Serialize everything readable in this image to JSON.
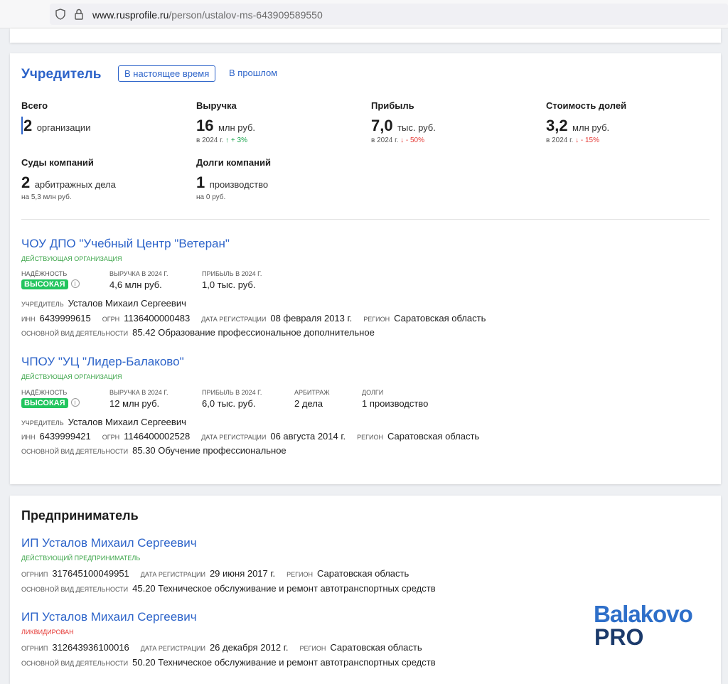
{
  "browser": {
    "url_domain": "www.rusprofile.ru",
    "url_path": "/person/ustalov-ms-643909589550"
  },
  "founder": {
    "title": "Учредитель",
    "tabs": [
      "В настоящее время",
      "В прошлом"
    ],
    "stats": {
      "total": {
        "label": "Всего",
        "value": "2",
        "unit": "организации"
      },
      "revenue": {
        "label": "Выручка",
        "value": "16",
        "unit": "млн руб.",
        "period": "в 2024 г.",
        "change": "↑ + 3%"
      },
      "profit": {
        "label": "Прибыль",
        "value": "7,0",
        "unit": "тыс. руб.",
        "period": "в 2024 г.",
        "change": "↓ - 50%"
      },
      "shares": {
        "label": "Стоимость долей",
        "value": "3,2",
        "unit": "млн руб.",
        "period": "в 2024 г.",
        "change": "↓ - 15%"
      },
      "courts": {
        "label": "Суды компаний",
        "value": "2",
        "unit": "арбитражных дела",
        "sub": "на 5,3 млн руб."
      },
      "debts": {
        "label": "Долги компаний",
        "value": "1",
        "unit": "производство",
        "sub": "на 0 руб."
      }
    },
    "orgs": [
      {
        "name": "ЧОУ ДПО \"Учебный Центр \"Ветеран\"",
        "status": "Действующая организация",
        "reliability_label": "Надёжность",
        "reliability": "ВЫСОКАЯ",
        "revenue_label": "Выручка в 2024 г.",
        "revenue": "4,6 млн руб.",
        "profit_label": "Прибыль в 2024 г.",
        "profit": "1,0 тыс. руб.",
        "founder_label": "Учредитель",
        "founder": "Усталов Михаил Сергеевич",
        "inn_label": "ИНН",
        "inn": "6439999615",
        "ogrn_label": "ОГРН",
        "ogrn": "1136400000483",
        "reg_label": "Дата регистрации",
        "reg": "08 февраля 2013 г.",
        "region_label": "Регион",
        "region": "Саратовская область",
        "activity_label": "Основной вид деятельности",
        "activity": "85.42 Образование профессиональное дополнительное"
      },
      {
        "name": "ЧПОУ \"УЦ \"Лидер-Балаково\"",
        "status": "Действующая организация",
        "reliability_label": "Надёжность",
        "reliability": "ВЫСОКАЯ",
        "revenue_label": "Выручка в 2024 г.",
        "revenue": "12 млн руб.",
        "profit_label": "Прибыль в 2024 г.",
        "profit": "6,0 тыс. руб.",
        "arbitrage_label": "Арбитраж",
        "arbitrage": "2 дела",
        "debts_label": "Долги",
        "debts": "1 производство",
        "founder_label": "Учредитель",
        "founder": "Усталов Михаил Сергеевич",
        "inn_label": "ИНН",
        "inn": "6439999421",
        "ogrn_label": "ОГРН",
        "ogrn": "1146400002528",
        "reg_label": "Дата регистрации",
        "reg": "06 августа 2014 г.",
        "region_label": "Регион",
        "region": "Саратовская область",
        "activity_label": "Основной вид деятельности",
        "activity": "85.30 Обучение профессиональное"
      }
    ]
  },
  "entrepreneur": {
    "title": "Предприниматель",
    "items": [
      {
        "name": "ИП Усталов Михаил Сергеевич",
        "status": "Действующий предприниматель",
        "ogrnip_label": "ОГРНИП",
        "ogrnip": "317645100049951",
        "reg_label": "Дата регистрации",
        "reg": "29 июня 2017 г.",
        "region_label": "Регион",
        "region": "Саратовская область",
        "activity_label": "Основной вид деятельности",
        "activity": "45.20 Техническое обслуживание и ремонт автотранспортных средств"
      },
      {
        "name": "ИП Усталов Михаил Сергеевич",
        "status": "Ликвидирован",
        "ogrnip_label": "ОГРНИП",
        "ogrnip": "312643936100016",
        "reg_label": "Дата регистрации",
        "reg": "26 декабря 2012 г.",
        "region_label": "Регион",
        "region": "Саратовская область",
        "activity_label": "Основной вид деятельности",
        "activity": "50.20 Техническое обслуживание и ремонт автотранспортных средств"
      }
    ]
  },
  "watermark": {
    "line1": "Balakovo",
    "line2": "PRO"
  },
  "colors": {
    "accent": "#2c63c9",
    "status_active": "#3ea64b",
    "status_closed": "#e53935",
    "badge": "#22c55e"
  }
}
